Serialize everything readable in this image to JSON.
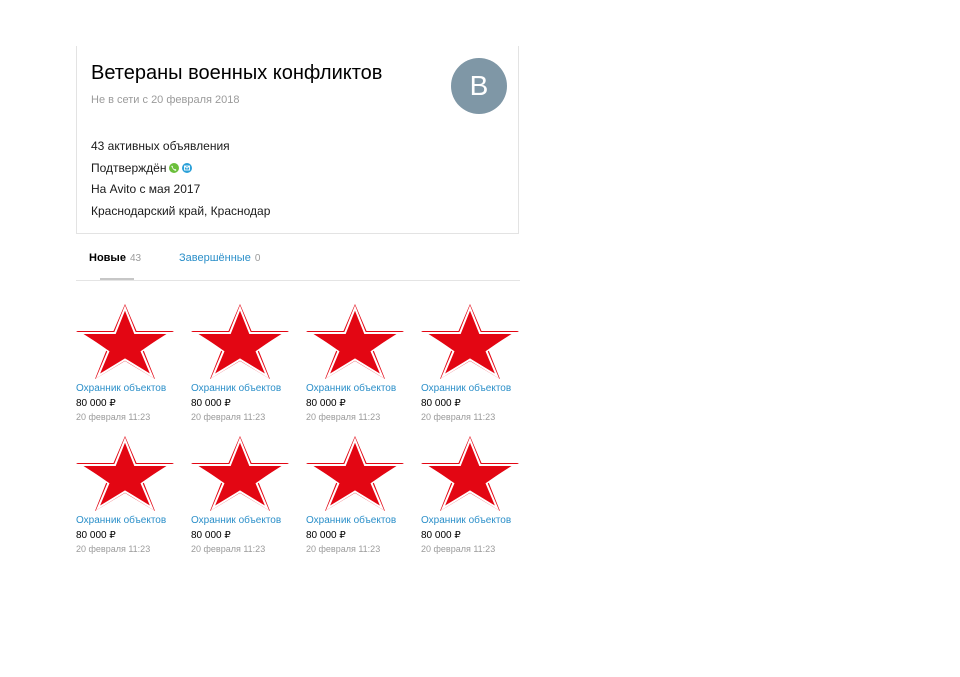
{
  "profile": {
    "name": "Ветераны военных конфликтов",
    "status": "Не в сети с 20 февраля 2018",
    "avatar_letter": "В",
    "active_ads": "43 активных объявления",
    "verified_label": "Подтверждён",
    "since": "На Avito с мая 2017",
    "location": "Краснодарский край, Краснодар"
  },
  "tabs": [
    {
      "label": "Новые",
      "count": "43"
    },
    {
      "label": "Завершённые",
      "count": "0"
    }
  ],
  "items": [
    {
      "title": "Охранник объектов",
      "price": "80 000 ₽",
      "date": "20 февраля 11:23",
      "icon": "red-star-image"
    },
    {
      "title": "Охранник объектов",
      "price": "80 000 ₽",
      "date": "20 февраля 11:23",
      "icon": "red-star-image"
    },
    {
      "title": "Охранник объектов",
      "price": "80 000 ₽",
      "date": "20 февраля 11:23",
      "icon": "red-star-image"
    },
    {
      "title": "Охранник объектов",
      "price": "80 000 ₽",
      "date": "20 февраля 11:23",
      "icon": "red-star-image"
    },
    {
      "title": "Охранник объектов",
      "price": "80 000 ₽",
      "date": "20 февраля 11:23",
      "icon": "red-star-image"
    },
    {
      "title": "Охранник объектов",
      "price": "80 000 ₽",
      "date": "20 февраля 11:23",
      "icon": "red-star-image"
    },
    {
      "title": "Охранник объектов",
      "price": "80 000 ₽",
      "date": "20 февраля 11:23",
      "icon": "red-star-image"
    },
    {
      "title": "Охранник объектов",
      "price": "80 000 ₽",
      "date": "20 февраля 11:23",
      "icon": "red-star-image"
    }
  ],
  "colors": {
    "link": "#2b8fc9",
    "avatar_bg": "#7f97a6",
    "star_red": "#e30613",
    "phone_verified": "#6bbf3b",
    "mail_verified": "#2aa0d8"
  }
}
